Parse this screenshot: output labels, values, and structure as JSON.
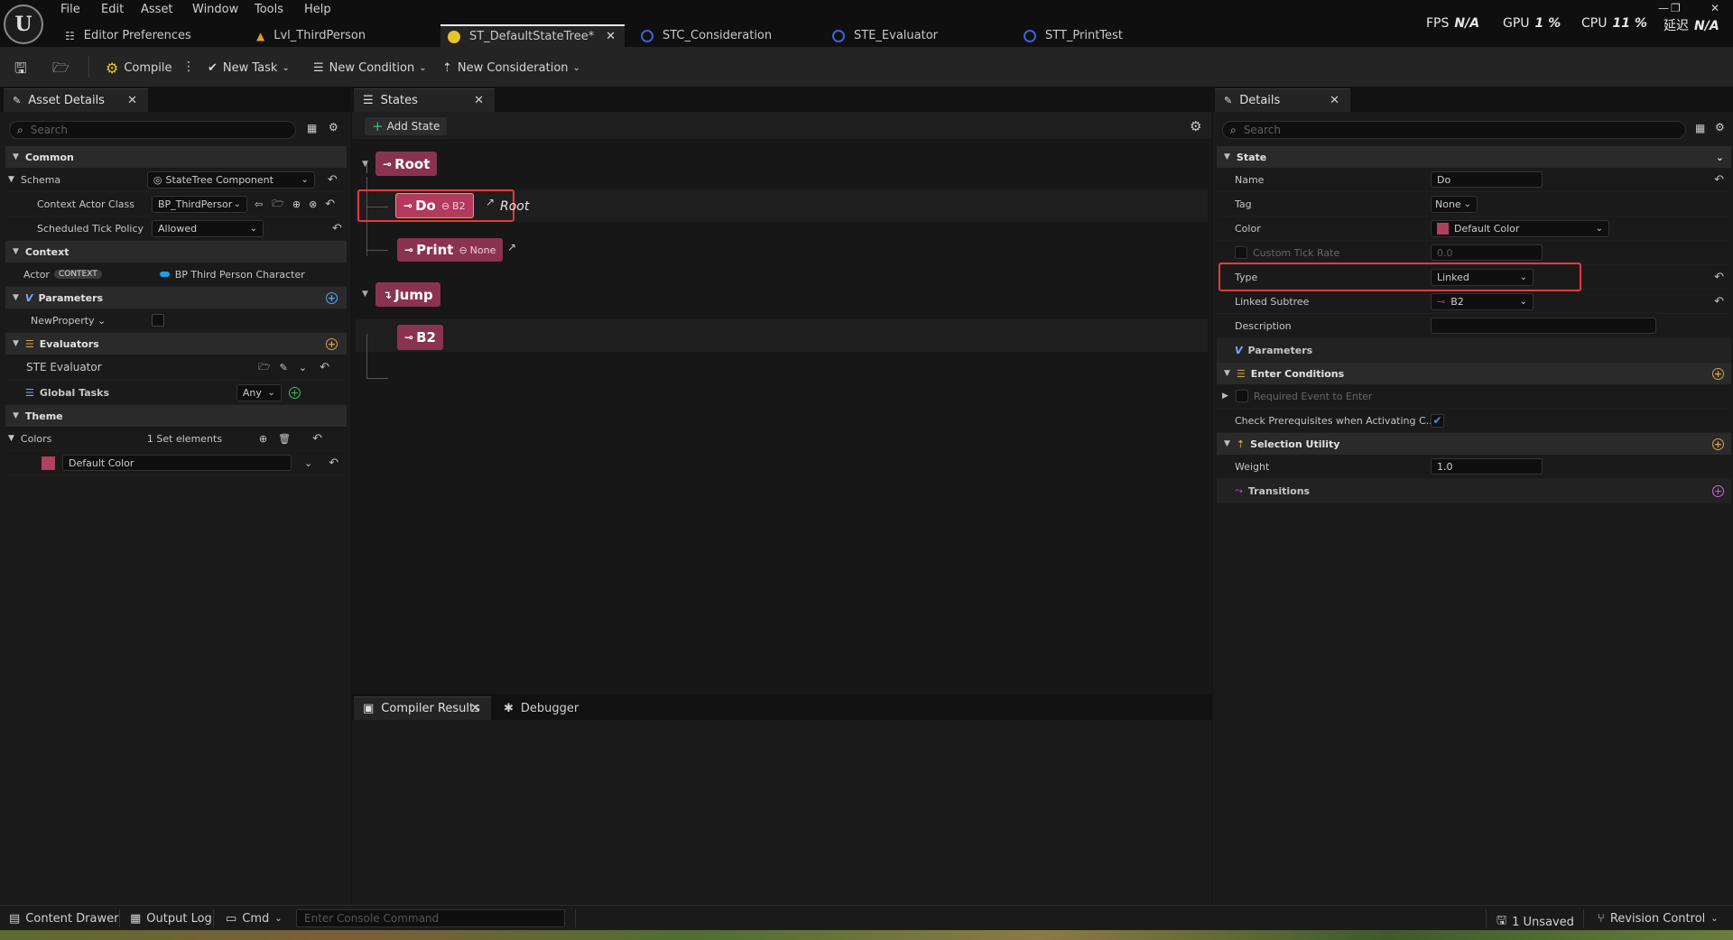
{
  "menu": [
    "File",
    "Edit",
    "Asset",
    "Window",
    "Tools",
    "Help"
  ],
  "doc_tabs": [
    {
      "label": "Editor Preferences",
      "icon": "sliders-icon"
    },
    {
      "label": "Lvl_ThirdPerson",
      "icon": "level-icon"
    },
    {
      "label": "ST_DefaultStateTree*",
      "icon": "statetree-icon",
      "active": true
    },
    {
      "label": "STC_Consideration",
      "icon": "blueprint-icon"
    },
    {
      "label": "STE_Evaluator",
      "icon": "blueprint-icon"
    },
    {
      "label": "STT_PrintTest",
      "icon": "blueprint-icon"
    }
  ],
  "perf": {
    "fps_label": "FPS",
    "fps_value": "N/A",
    "gpu_label": "GPU",
    "gpu_value": "1 %",
    "cpu_label": "CPU",
    "cpu_value": "11 %",
    "lat_label": "延迟",
    "lat_value": "N/A"
  },
  "toolbar": {
    "compile": "Compile",
    "new_task": "New Task",
    "new_condition": "New Condition",
    "new_consideration": "New Consideration"
  },
  "asset_details": {
    "tab": "Asset Details",
    "search_placeholder": "Search",
    "common": "Common",
    "schema_label": "Schema",
    "schema_value": "StateTree Component",
    "context_actor_class_label": "Context Actor Class",
    "context_actor_class_value": "BP_ThirdPersor",
    "scheduled_tick_label": "Scheduled Tick Policy",
    "scheduled_tick_value": "Allowed",
    "context": "Context",
    "actor_label": "Actor",
    "actor_badge": "CONTEXT",
    "actor_value": "BP Third Person Character",
    "parameters": "Parameters",
    "new_property": "NewProperty",
    "evaluators": "Evaluators",
    "ste_evaluator": "STE Evaluator",
    "global_tasks": "Global Tasks",
    "global_tasks_value": "Any",
    "theme": "Theme",
    "colors_label": "Colors",
    "colors_value": "1 Set elements",
    "default_color": "Default Color"
  },
  "states_panel": {
    "tab": "States",
    "add_state": "Add State",
    "states": {
      "root": "Root",
      "do": "Do",
      "do_link": "B2",
      "do_transition": "Root",
      "print": "Print",
      "print_link": "None",
      "jump": "Jump",
      "b2": "B2"
    }
  },
  "bottom_panel": {
    "compiler_results": "Compiler Results",
    "debugger": "Debugger"
  },
  "details": {
    "tab": "Details",
    "search_placeholder": "Search",
    "state_cat": "State",
    "name_label": "Name",
    "name_value": "Do",
    "tag_label": "Tag",
    "tag_value": "None",
    "color_label": "Color",
    "color_value": "Default Color",
    "custom_tick_label": "Custom Tick Rate",
    "custom_tick_value": "0.0",
    "type_label": "Type",
    "type_value": "Linked",
    "linked_subtree_label": "Linked Subtree",
    "linked_subtree_value": "B2",
    "description_label": "Description",
    "parameters": "Parameters",
    "enter_conditions": "Enter Conditions",
    "required_event": "Required Event to Enter",
    "check_prereq": "Check Prerequisites when Activating C...",
    "selection_utility": "Selection Utility",
    "weight_label": "Weight",
    "weight_value": "1.0",
    "transitions": "Transitions"
  },
  "statusbar": {
    "content_drawer": "Content Drawer",
    "output_log": "Output Log",
    "cmd": "Cmd",
    "console_placeholder": "Enter Console Command",
    "unsaved": "1 Unsaved",
    "revision_control": "Revision Control"
  },
  "colors": {
    "state_accent": "#8a3350",
    "highlight": "#e8393b",
    "checkbox_blue": "#1a6fd6"
  }
}
